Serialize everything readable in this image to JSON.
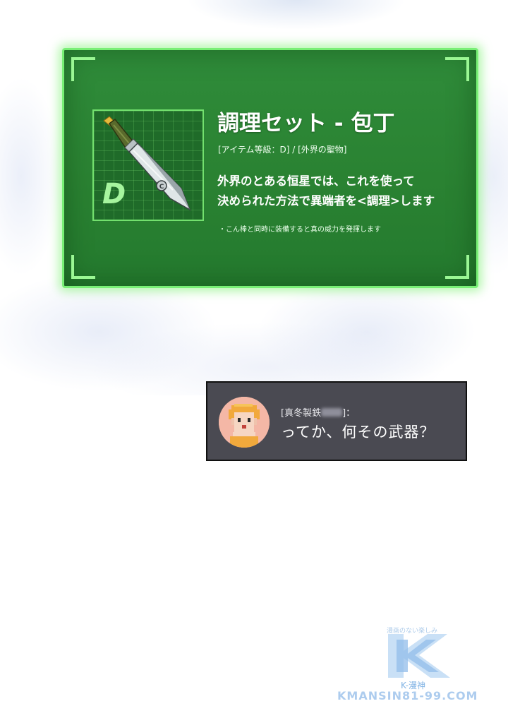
{
  "item_card": {
    "name": "調理セット - 包丁",
    "meta": "[アイテム等級：D] / [外界の聖物]",
    "description_lines": [
      "外界のとある恒星では、これを使って",
      "決められた方法で異端者を<調理>します"
    ],
    "note": "・こん棒と同時に装備すると真の威力を発揮します",
    "grade": "D",
    "icon": "kitchen-knife-icon",
    "colors": {
      "panel": "#2a8232",
      "glow": "#79ef76",
      "grade": "#a6f59e"
    }
  },
  "chat": {
    "speaker_prefix": "[真冬製鉄",
    "speaker_suffix": "]：",
    "message": "ってか、何その武器？",
    "avatar": "pixel-avatar-icon",
    "colors": {
      "background": "#4a4a52"
    }
  },
  "watermark": {
    "tagline": "漫画のない楽しみ",
    "logo_letter": "K",
    "subtitle": "K-漫神",
    "url": "KMANSIN81-99.COM"
  }
}
